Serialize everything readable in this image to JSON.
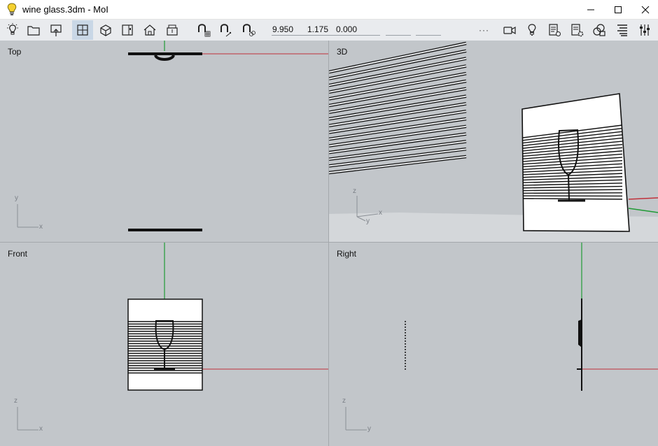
{
  "window": {
    "title": "wine glass.3dm - MoI",
    "app_icon": "lightbulb-icon",
    "controls": [
      "minimize",
      "maximize",
      "close"
    ]
  },
  "toolbar": {
    "left_icons": [
      "lightbulb-menu-icon",
      "open-folder-icon",
      "export-icon",
      "four-view-icon",
      "3d-view-icon",
      "split-view-icon",
      "home-view-icon",
      "box-view-icon"
    ],
    "snap_icons": [
      "grid-snap-icon",
      "object-snap-icon",
      "straight-snap-icon"
    ],
    "coordinates": {
      "x": "9.950",
      "y": "1.175",
      "z": "0.000"
    },
    "more": "···",
    "right_icons": [
      "camera-icon",
      "lightbulb-icon",
      "script-icon",
      "options-icon",
      "shapes-icon",
      "align-icon",
      "settings-sliders-icon"
    ]
  },
  "viewports": {
    "top": {
      "label": "Top",
      "axes": [
        "y",
        "x"
      ]
    },
    "perspective": {
      "label": "3D",
      "axes": [
        "z",
        "x",
        "y"
      ]
    },
    "front": {
      "label": "Front",
      "axes": [
        "z",
        "x"
      ]
    },
    "right": {
      "label": "Right",
      "axes": [
        "z",
        "y"
      ]
    }
  },
  "colors": {
    "viewport_bg": "#c2c6ca",
    "x_axis": "#c0303a",
    "y_axis": "#1f9a35",
    "geometry": "#111111",
    "toolbar_bg": "#e9ebee",
    "active_button": "#c9d7e6"
  }
}
